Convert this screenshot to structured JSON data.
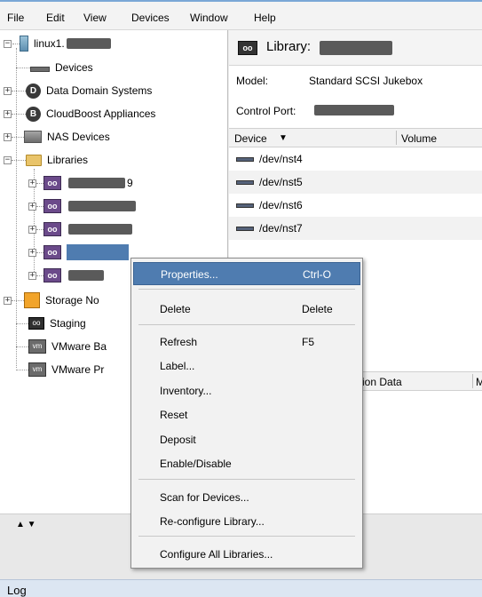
{
  "menubar": {
    "items": [
      "File",
      "Edit",
      "View",
      "Devices",
      "Window",
      "Help"
    ]
  },
  "tree": {
    "root": "linux1.",
    "items": [
      {
        "label": "Devices",
        "icon": "device-icon"
      },
      {
        "label": "Data Domain Systems",
        "icon": "data-domain-icon"
      },
      {
        "label": "CloudBoost Appliances",
        "icon": "cloudboost-icon"
      },
      {
        "label": "NAS Devices",
        "icon": "nas-icon"
      },
      {
        "label": "Libraries",
        "icon": "folder-icon"
      },
      {
        "label": "Storage No",
        "icon": "storage-node-icon"
      },
      {
        "label": "Staging",
        "icon": "staging-icon"
      },
      {
        "label": "VMware Ba",
        "icon": "vmware-icon"
      },
      {
        "label": "VMware Pr",
        "icon": "vmware-icon"
      }
    ],
    "library_suffixes": [
      "9",
      "",
      "",
      "",
      ""
    ]
  },
  "library": {
    "title": "Library:",
    "model_label": "Model:",
    "model_value": "Standard SCSI Jukebox",
    "control_port_label": "Control Port:",
    "columns": {
      "device": "Device",
      "volume": "Volume"
    },
    "devices": [
      "/dev/nst4",
      "/dev/nst5",
      "/dev/nst6",
      "/dev/nst7"
    ],
    "bottom_columns": {
      "data": "ation Data",
      "more": "M"
    }
  },
  "context_menu": {
    "items": [
      {
        "label": "Properties...",
        "shortcut": "Ctrl-O"
      },
      {
        "label": "Delete",
        "shortcut": "Delete"
      },
      {
        "label": "Refresh",
        "shortcut": "F5"
      },
      {
        "label": "Label..."
      },
      {
        "label": "Inventory..."
      },
      {
        "label": "Reset"
      },
      {
        "label": "Deposit"
      },
      {
        "label": "Enable/Disable"
      },
      {
        "label": "Scan for Devices..."
      },
      {
        "label": "Re-configure Library..."
      },
      {
        "label": "Configure All Libraries..."
      }
    ]
  },
  "status": {
    "arrows": "▲ ▼"
  },
  "log": {
    "label": "Log"
  },
  "colors": {
    "highlight": "#4f7cb0",
    "library_icon": "#6b4a8a"
  }
}
